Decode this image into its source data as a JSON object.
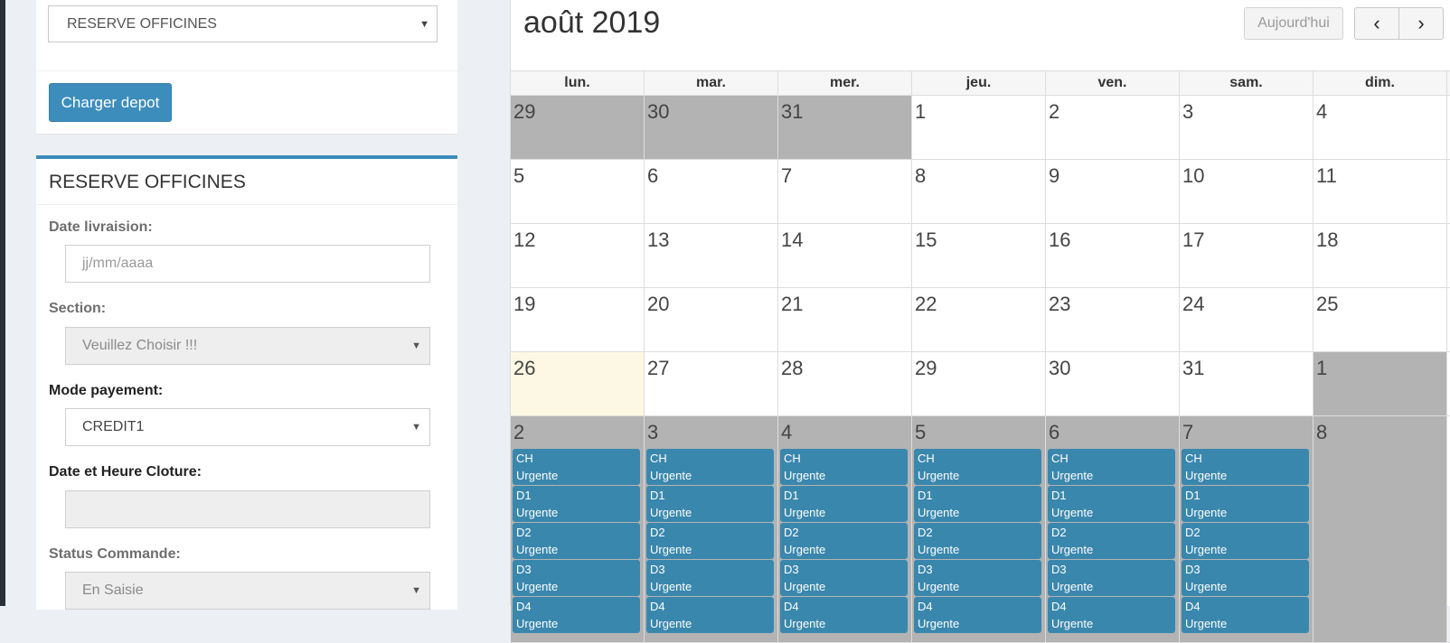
{
  "depot_selector": {
    "value": "RESERVE OFFICINES"
  },
  "load_button": {
    "label": "Charger depot"
  },
  "form": {
    "title": "RESERVE OFFICINES",
    "delivery_date": {
      "label": "Date livraision:",
      "placeholder": "jj/mm/aaaa"
    },
    "section": {
      "label": "Section:",
      "value": "Veuillez Choisir !!!"
    },
    "payment_mode": {
      "label": "Mode payement:",
      "value": "CREDIT1"
    },
    "closing_datetime": {
      "label": "Date et Heure Cloture:",
      "value": ""
    },
    "order_status": {
      "label": "Status Commande:",
      "value": "En Saisie"
    }
  },
  "calendar": {
    "title": "août 2019",
    "today_button": "Aujourd'hui",
    "prev_icon": "chevron-left-icon",
    "next_icon": "chevron-right-icon",
    "prev_glyph": "‹",
    "next_glyph": "›",
    "weekdays": [
      "lun.",
      "mar.",
      "mer.",
      "jeu.",
      "ven.",
      "sam.",
      "dim."
    ],
    "weeks": [
      [
        "29",
        "30",
        "31",
        "1",
        "2",
        "3",
        "4"
      ],
      [
        "5",
        "6",
        "7",
        "8",
        "9",
        "10",
        "11"
      ],
      [
        "12",
        "13",
        "14",
        "15",
        "16",
        "17",
        "18"
      ],
      [
        "19",
        "20",
        "21",
        "22",
        "23",
        "24",
        "25"
      ],
      [
        "26",
        "27",
        "28",
        "29",
        "30",
        "31",
        "1"
      ],
      [
        "2",
        "3",
        "4",
        "5",
        "6",
        "7",
        "8"
      ]
    ],
    "event_lines": [
      [
        "CH",
        "Urgente"
      ],
      [
        "D1",
        "Urgente"
      ],
      [
        "D2",
        "Urgente"
      ],
      [
        "D3",
        "Urgente"
      ],
      [
        "D4",
        "Urgente"
      ]
    ],
    "colors": {
      "event": "#3a87ad",
      "other_month": "#b3b3b3",
      "today": "#fcf8e3",
      "primary": "#3c8dbc"
    }
  }
}
